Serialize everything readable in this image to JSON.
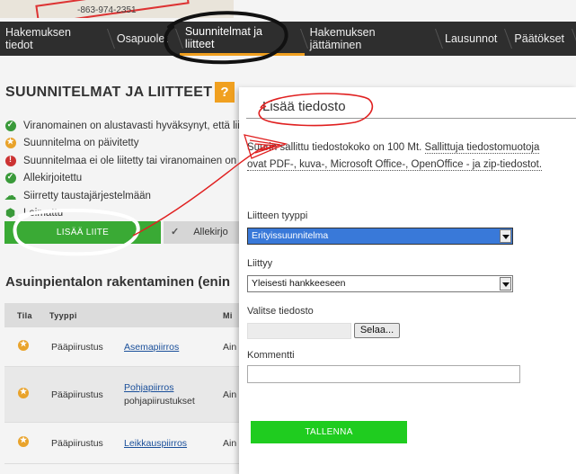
{
  "top_strip": {
    "phone": "-863-974-2351"
  },
  "nav": {
    "items": [
      {
        "label": "Hakemuksen tiedot",
        "active": false
      },
      {
        "label": "Osapuolet",
        "active": false
      },
      {
        "label": "Suunnitelmat ja liitteet",
        "active": true
      },
      {
        "label": "Hakemuksen jättäminen",
        "active": false
      },
      {
        "label": "Lausunnot",
        "active": false
      },
      {
        "label": "Päätökset",
        "active": false
      }
    ]
  },
  "section": {
    "title": "SUUNNITELMAT JA LIITTEET",
    "help_label": "?"
  },
  "legend": [
    {
      "icon": "check-circle-icon",
      "color": "#3a9a3a",
      "text": "Viranomainen on alustavasti hyväksynyt, että liite"
    },
    {
      "icon": "star-circle-icon",
      "color": "#e9a32b",
      "text": "Suunnitelma on päivitetty"
    },
    {
      "icon": "exclamation-circle-icon",
      "color": "#cc3333",
      "text": "Suunnitelmaa ei ole liitetty tai viranomainen on"
    },
    {
      "icon": "check-circle-icon",
      "color": "#3a9a3a",
      "text": "Allekirjoitettu"
    },
    {
      "icon": "cloud-upload-icon",
      "color": "#3a9a3a",
      "text": "Siirretty taustajärjestelmään"
    },
    {
      "icon": "stamp-icon",
      "color": "#3a9a3a",
      "text": "Leimattu"
    }
  ],
  "actions": {
    "add_label": "LISÄÄ LIITE",
    "sign_label": "Allekirjo"
  },
  "subheading": "Asuinpientalon rakentaminen (enin",
  "table": {
    "headers": [
      "Tila",
      "Tyyppi",
      "Mi"
    ],
    "rows": [
      {
        "type": "Pääpiirustus",
        "name": "Asemapiirros",
        "subtext": "",
        "col4": "Ain"
      },
      {
        "type": "Pääpiirustus",
        "name": "Pohjapiirros",
        "subtext": "pohjapiirustukset",
        "col4": "Ain"
      },
      {
        "type": "Pääpiirustus",
        "name": "Leikkauspiirros",
        "subtext": "",
        "col4": "Ain"
      }
    ]
  },
  "dialog": {
    "title": "Lisää tiedosto",
    "info_prefix": "Suurin sallittu tiedostokoko on 100 Mt. ",
    "info_link": "Sallittuja tiedostomuotoja ovat PDF-, kuva-, Microsoft Office-, OpenOffice - ja zip-tiedostot.",
    "type_label": "Liitteen tyyppi",
    "type_value": "Erityissuunnitelma",
    "relates_label": "Liittyy",
    "relates_value": "Yleisesti hankkeeseen",
    "file_label": "Valitse tiedosto",
    "browse_label": "Selaa...",
    "comment_label": "Kommentti",
    "comment_value": "",
    "save_label": "TALLENNA"
  },
  "colors": {
    "accent": "#f0a020",
    "nav_bg": "#2e2e2e",
    "green_button": "#3aaa35",
    "save_green": "#1fcc1f",
    "annotation_red": "#e02020"
  }
}
